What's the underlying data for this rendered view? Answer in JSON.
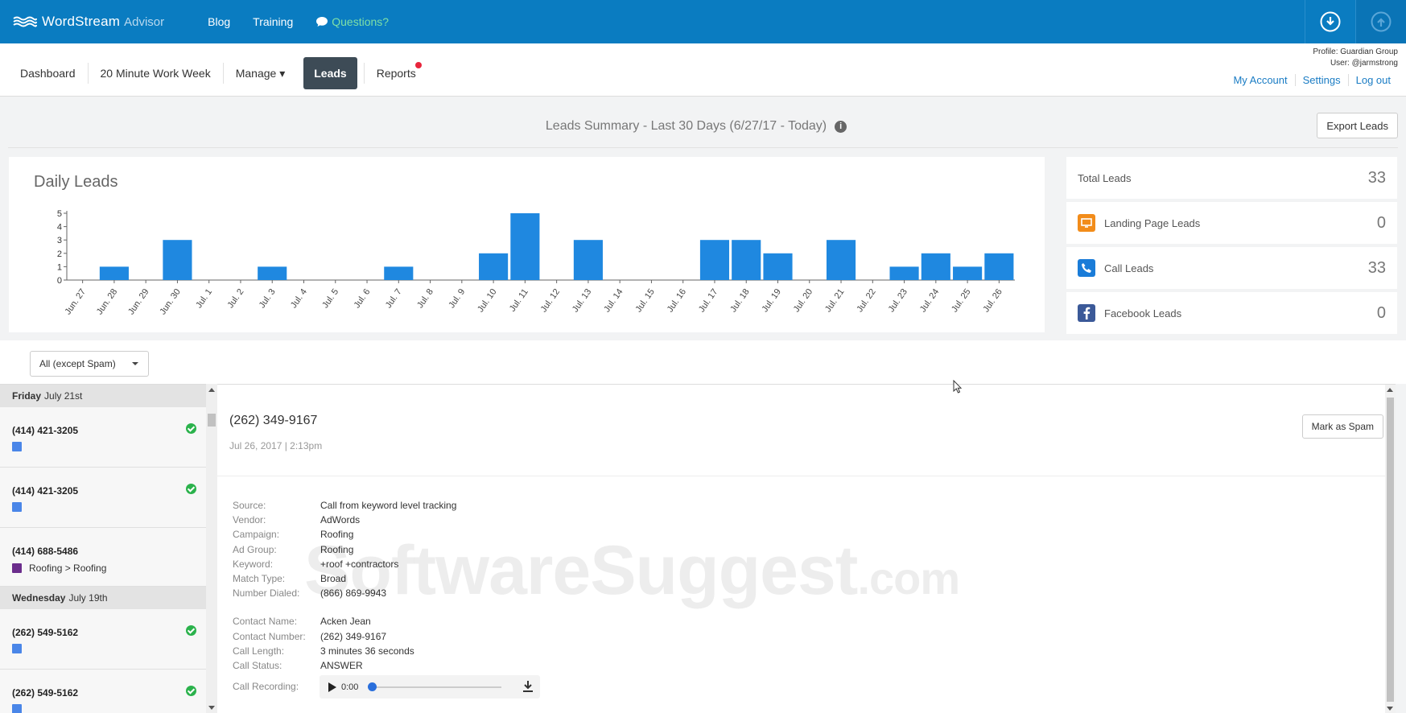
{
  "brand": {
    "name": "WordStream",
    "sub": "Advisor"
  },
  "topnav": {
    "blog": "Blog",
    "training": "Training",
    "questions": "Questions?"
  },
  "subnav": {
    "dashboard": "Dashboard",
    "work_week": "20 Minute Work Week",
    "manage": "Manage ▾",
    "leads": "Leads",
    "reports": "Reports"
  },
  "profile": {
    "line1": "Profile: Guardian Group",
    "line2": "User: @jarmstrong",
    "my_account": "My Account",
    "settings": "Settings",
    "logout": "Log out"
  },
  "summary": {
    "title": "Leads Summary - Last 30 Days (6/27/17 - Today)",
    "info": "i",
    "export": "Export Leads"
  },
  "chart_data": {
    "type": "bar",
    "title": "Daily Leads",
    "categories": [
      "Jun. 27",
      "Jun. 28",
      "Jun. 29",
      "Jun. 30",
      "Jul. 1",
      "Jul. 2",
      "Jul. 3",
      "Jul. 4",
      "Jul. 5",
      "Jul. 6",
      "Jul. 7",
      "Jul. 8",
      "Jul. 9",
      "Jul. 10",
      "Jul. 11",
      "Jul. 12",
      "Jul. 13",
      "Jul. 14",
      "Jul. 15",
      "Jul. 16",
      "Jul. 17",
      "Jul. 18",
      "Jul. 19",
      "Jul. 20",
      "Jul. 21",
      "Jul. 22",
      "Jul. 23",
      "Jul. 24",
      "Jul. 25",
      "Jul. 26"
    ],
    "values": [
      0,
      1,
      0,
      3,
      0,
      0,
      1,
      0,
      0,
      0,
      1,
      0,
      0,
      2,
      5,
      0,
      3,
      0,
      0,
      0,
      3,
      3,
      2,
      0,
      3,
      0,
      1,
      2,
      1,
      2
    ],
    "ylim": [
      0,
      5
    ],
    "yticks": [
      0,
      1,
      2,
      3,
      4,
      5
    ],
    "color": "#1f88e0"
  },
  "stats": [
    {
      "label": "Total Leads",
      "value": "33",
      "icon": "none"
    },
    {
      "label": "Landing Page Leads",
      "value": "0",
      "icon": "monitor-icon"
    },
    {
      "label": "Call Leads",
      "value": "33",
      "icon": "phone-icon"
    },
    {
      "label": "Facebook Leads",
      "value": "0",
      "icon": "facebook-icon"
    }
  ],
  "filter": {
    "selected": "All (except Spam)"
  },
  "leadlist": {
    "day1": {
      "weekday": "Friday",
      "date": "July 21st"
    },
    "day2": {
      "weekday": "Wednesday",
      "date": "July 19th"
    },
    "leads": [
      {
        "phone": "(414) 421-3205",
        "detail": ""
      },
      {
        "phone": "(414) 421-3205",
        "detail": ""
      },
      {
        "phone": "(414) 688-5486",
        "detail": "Roofing > Roofing"
      },
      {
        "phone": "(262) 549-5162",
        "detail": ""
      },
      {
        "phone": "(262) 549-5162",
        "detail": ""
      }
    ]
  },
  "detail": {
    "phone": "(262) 349-9167",
    "date": "Jul 26, 2017 | 2:13pm",
    "spam_button": "Mark as Spam",
    "fields": [
      {
        "k": "Source:",
        "v": "Call from keyword level tracking"
      },
      {
        "k": "Vendor:",
        "v": "AdWords"
      },
      {
        "k": "Campaign:",
        "v": "Roofing"
      },
      {
        "k": "Ad Group:",
        "v": "Roofing"
      },
      {
        "k": "Keyword:",
        "v": "+roof +contractors"
      },
      {
        "k": "Match Type:",
        "v": "Broad"
      },
      {
        "k": "Number Dialed:",
        "v": "(866) 869-9943"
      }
    ],
    "contact": [
      {
        "k": "Contact Name:",
        "v": "Acken Jean"
      },
      {
        "k": "Contact Number:",
        "v": "(262) 349-9167"
      },
      {
        "k": "Call Length:",
        "v": "3 minutes 36 seconds"
      },
      {
        "k": "Call Status:",
        "v": "ANSWER"
      }
    ],
    "recording_label": "Call Recording:",
    "recording_time": "0:00"
  },
  "watermark": {
    "main": "SoftwareSuggest",
    "suffix": ".com"
  }
}
